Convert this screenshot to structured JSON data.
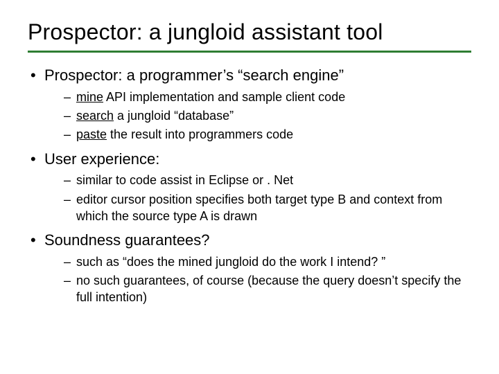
{
  "title": "Prospector: a jungloid assistant tool",
  "bullets": [
    {
      "text": "Prospector: a programmer’s “search engine”",
      "sub": [
        {
          "lead_u": "mine",
          "rest": " API implementation and sample client code"
        },
        {
          "lead_u": "search",
          "rest": " a jungloid “database”"
        },
        {
          "lead_u": "paste",
          "rest": " the result into programmers code"
        }
      ]
    },
    {
      "text": "User experience:",
      "sub": [
        {
          "text": "similar to code assist in Eclipse or . Net"
        },
        {
          "text": "editor cursor position specifies both target type B and context from which the source type A is drawn"
        }
      ]
    },
    {
      "text": "Soundness guarantees?",
      "sub": [
        {
          "text": "such as “does the mined jungloid do the work I intend? ”"
        },
        {
          "text": "no such guarantees, of course (because the query doesn’t specify the full intention)"
        }
      ]
    }
  ]
}
